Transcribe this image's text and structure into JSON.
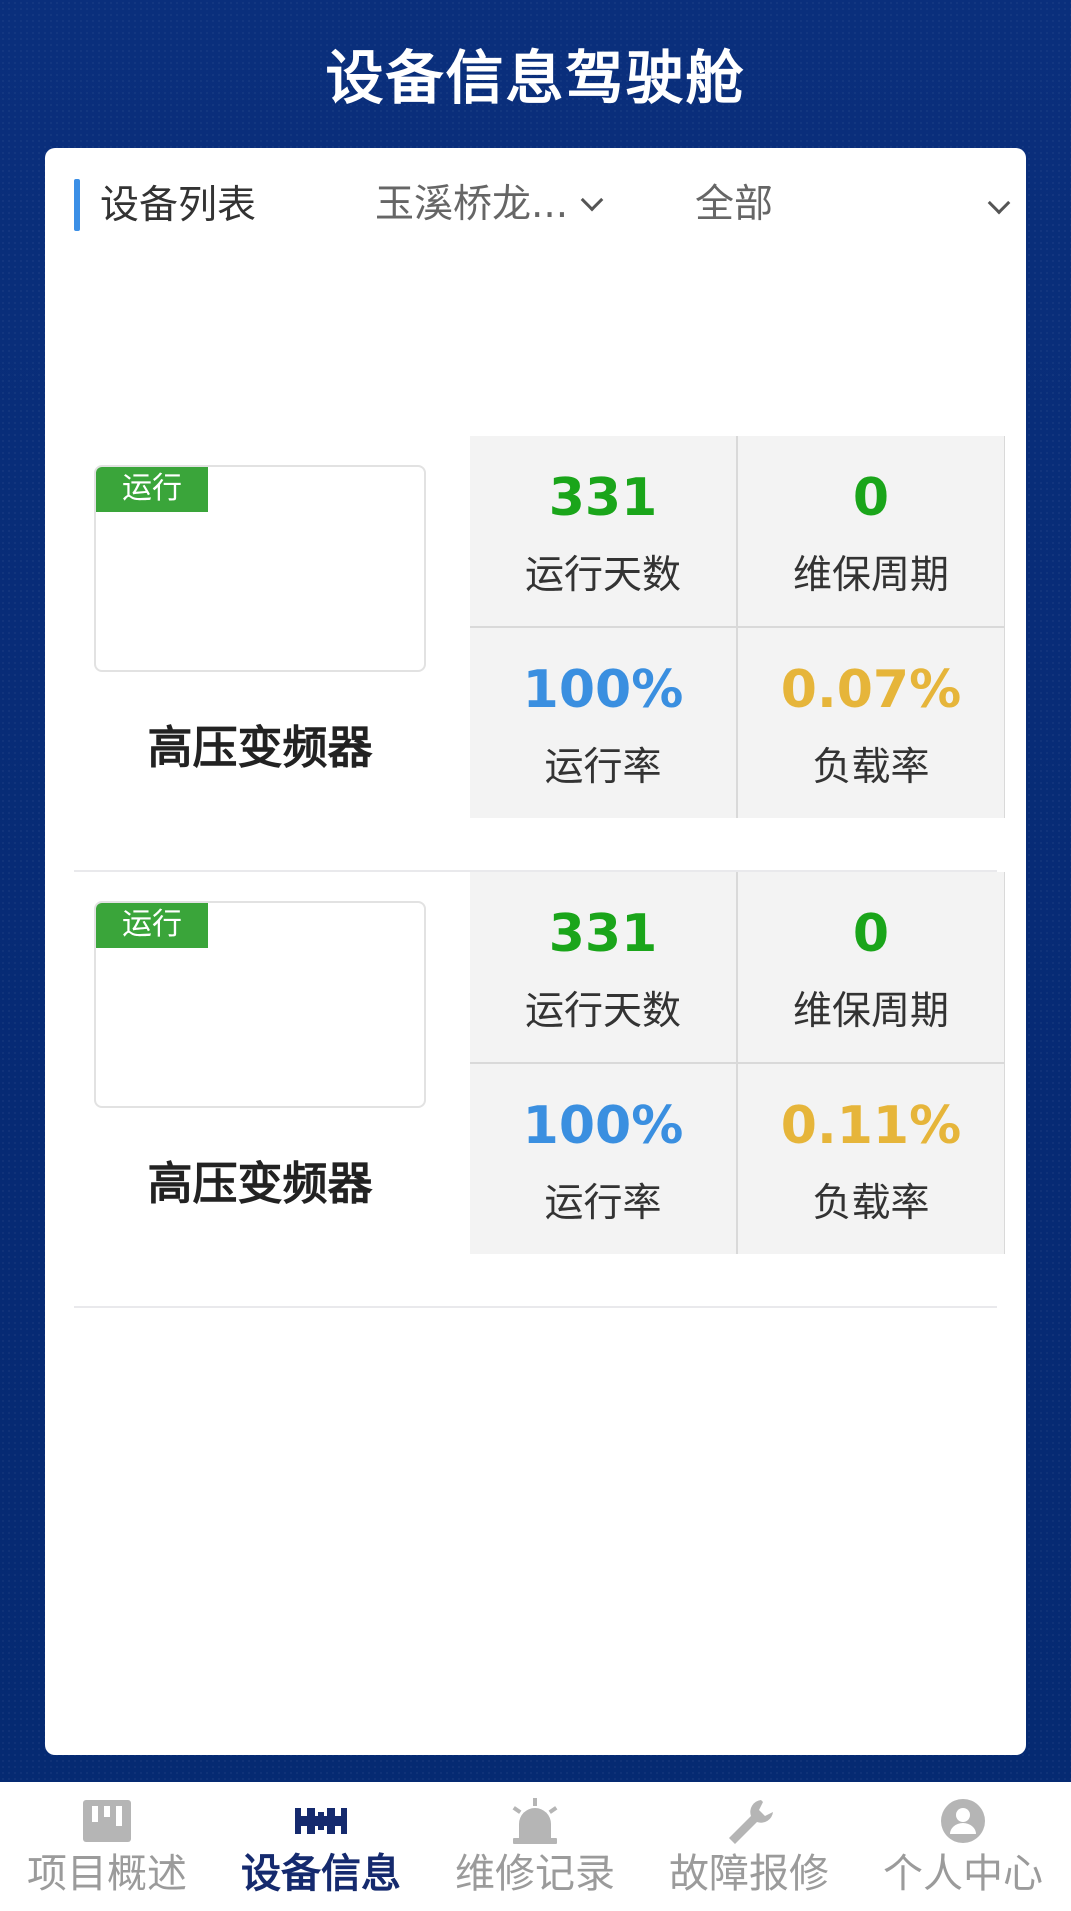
{
  "header": {
    "title": "设备信息驾驶舱"
  },
  "panel": {
    "title": "设备列表",
    "site_filter": "玉溪桥龙...",
    "status_filter": "全部"
  },
  "devices": [
    {
      "status": "运行",
      "name": "高压变频器",
      "stats": [
        {
          "value": "331",
          "label": "运行天数",
          "color": "#1aa51a"
        },
        {
          "value": "0",
          "label": "维保周期",
          "color": "#1aa51a"
        },
        {
          "value": "100%",
          "label": "运行率",
          "color": "#3a8fe0"
        },
        {
          "value": "0.07%",
          "label": "负载率",
          "color": "#e6b53a"
        }
      ]
    },
    {
      "status": "运行",
      "name": "高压变频器",
      "stats": [
        {
          "value": "331",
          "label": "运行天数",
          "color": "#1aa51a"
        },
        {
          "value": "0",
          "label": "维保周期",
          "color": "#1aa51a"
        },
        {
          "value": "100%",
          "label": "运行率",
          "color": "#3a8fe0"
        },
        {
          "value": "0.11%",
          "label": "负载率",
          "color": "#e6b53a"
        }
      ]
    }
  ],
  "tabbar": {
    "items": [
      {
        "label": "项目概述",
        "icon": "kanban-icon",
        "active": false
      },
      {
        "label": "设备信息",
        "icon": "device-icon",
        "active": true
      },
      {
        "label": "维修记录",
        "icon": "alarm-light-icon",
        "active": false
      },
      {
        "label": "故障报修",
        "icon": "wrench-icon",
        "active": false
      },
      {
        "label": "个人中心",
        "icon": "user-icon",
        "active": false
      }
    ]
  },
  "colors": {
    "background": "#062a74",
    "accent": "#3b8fe6",
    "status_running": "#3aa53a",
    "tab_active": "#152a6e",
    "tab_inactive": "#9b9b9b"
  }
}
